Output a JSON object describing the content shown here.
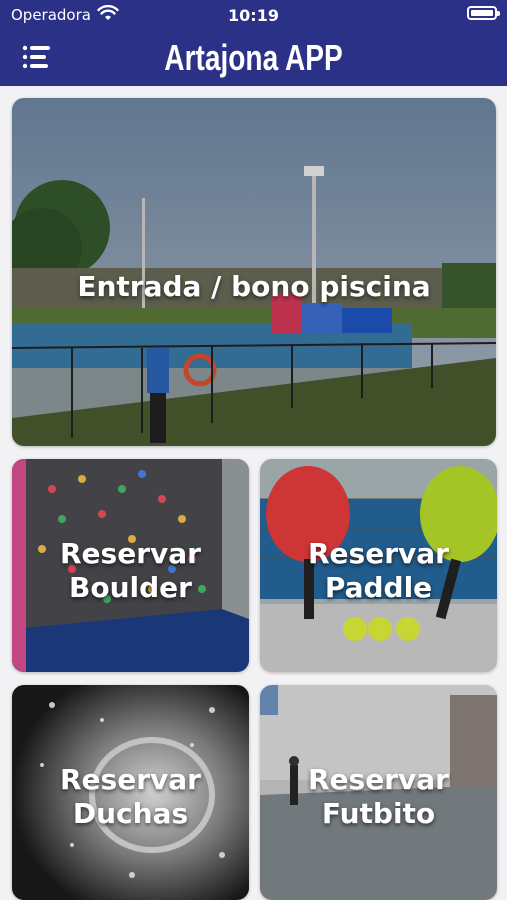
{
  "status_bar": {
    "carrier": "Operadora",
    "time": "10:19"
  },
  "header": {
    "title": "Artajona APP",
    "menu_icon": "hamburger-menu-icon"
  },
  "cards": {
    "pool": {
      "lines": [
        "Entrada / bono piscina"
      ]
    },
    "boulder": {
      "lines": [
        "Reservar",
        "Boulder"
      ]
    },
    "paddle": {
      "lines": [
        "Reservar",
        "Paddle"
      ]
    },
    "duchas": {
      "lines": [
        "Reservar",
        "Duchas"
      ]
    },
    "futbito": {
      "lines": [
        "Reservar",
        "Futbito"
      ]
    }
  },
  "colors": {
    "header_bg": "#2c3188",
    "background": "#f2f2f4"
  }
}
